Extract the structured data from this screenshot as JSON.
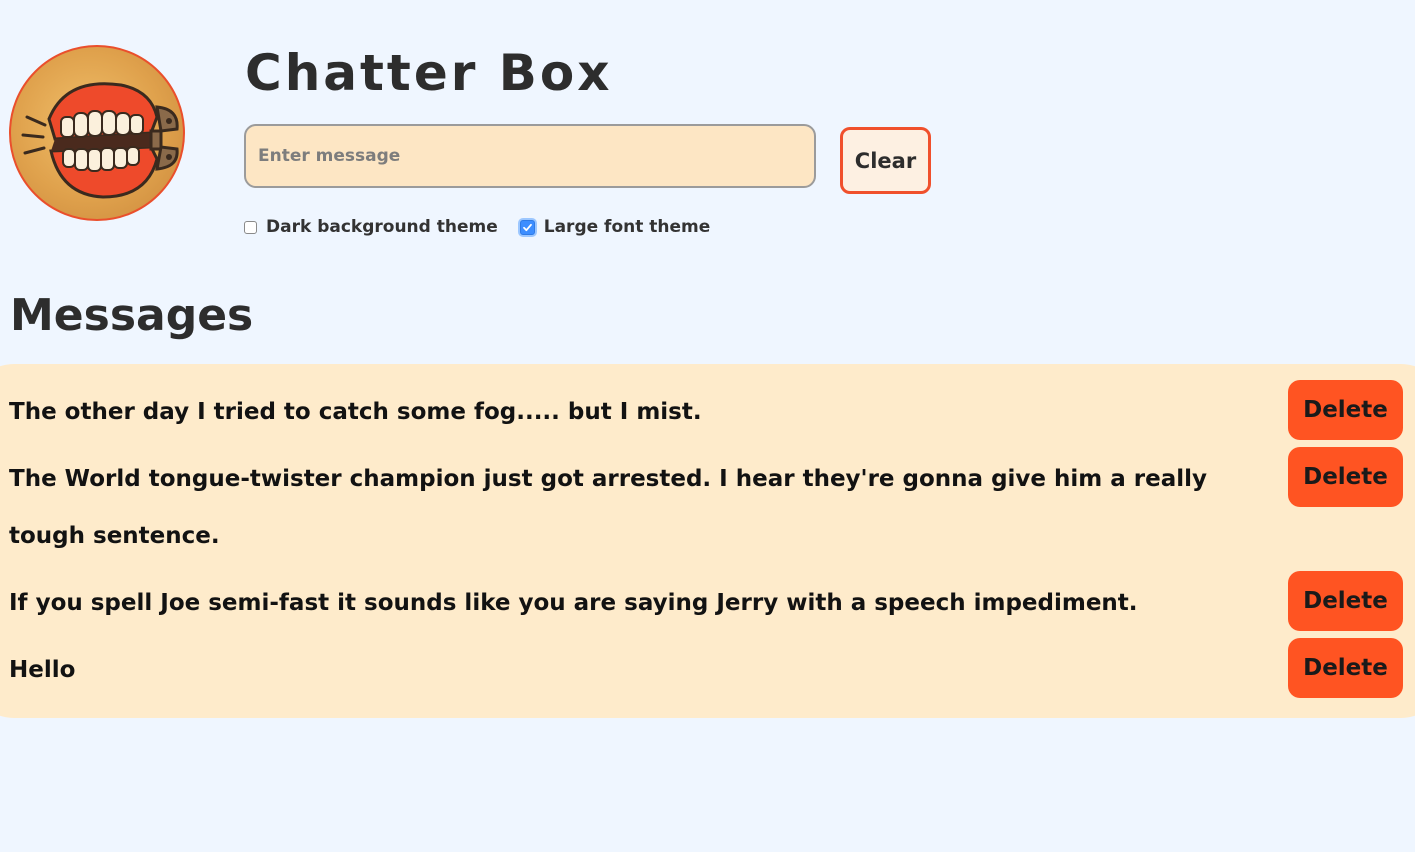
{
  "app": {
    "title": "Chatter Box",
    "logo_icon": "wind-up-teeth-icon"
  },
  "composer": {
    "placeholder": "Enter message",
    "value": "",
    "clear_label": "Clear"
  },
  "themes": {
    "dark": {
      "label": "Dark background theme",
      "checked": false
    },
    "large_font": {
      "label": "Large font theme",
      "checked": true
    }
  },
  "messages": {
    "heading": "Messages",
    "delete_label": "Delete",
    "items": [
      {
        "text": "The other day I tried to catch some fog..... but I mist."
      },
      {
        "text": "The World tongue-twister champion just got arrested. I hear they're gonna give him a really tough sentence."
      },
      {
        "text": "If you spell Joe semi-fast it sounds like you are saying Jerry with a speech impediment."
      },
      {
        "text": "Hello"
      }
    ]
  },
  "colors": {
    "page_background": "#eff6ff",
    "accent": "#ff5422",
    "panel": "#feebcb",
    "input_background": "#fde6c4",
    "checkbox_checked": "#3d8eff"
  }
}
